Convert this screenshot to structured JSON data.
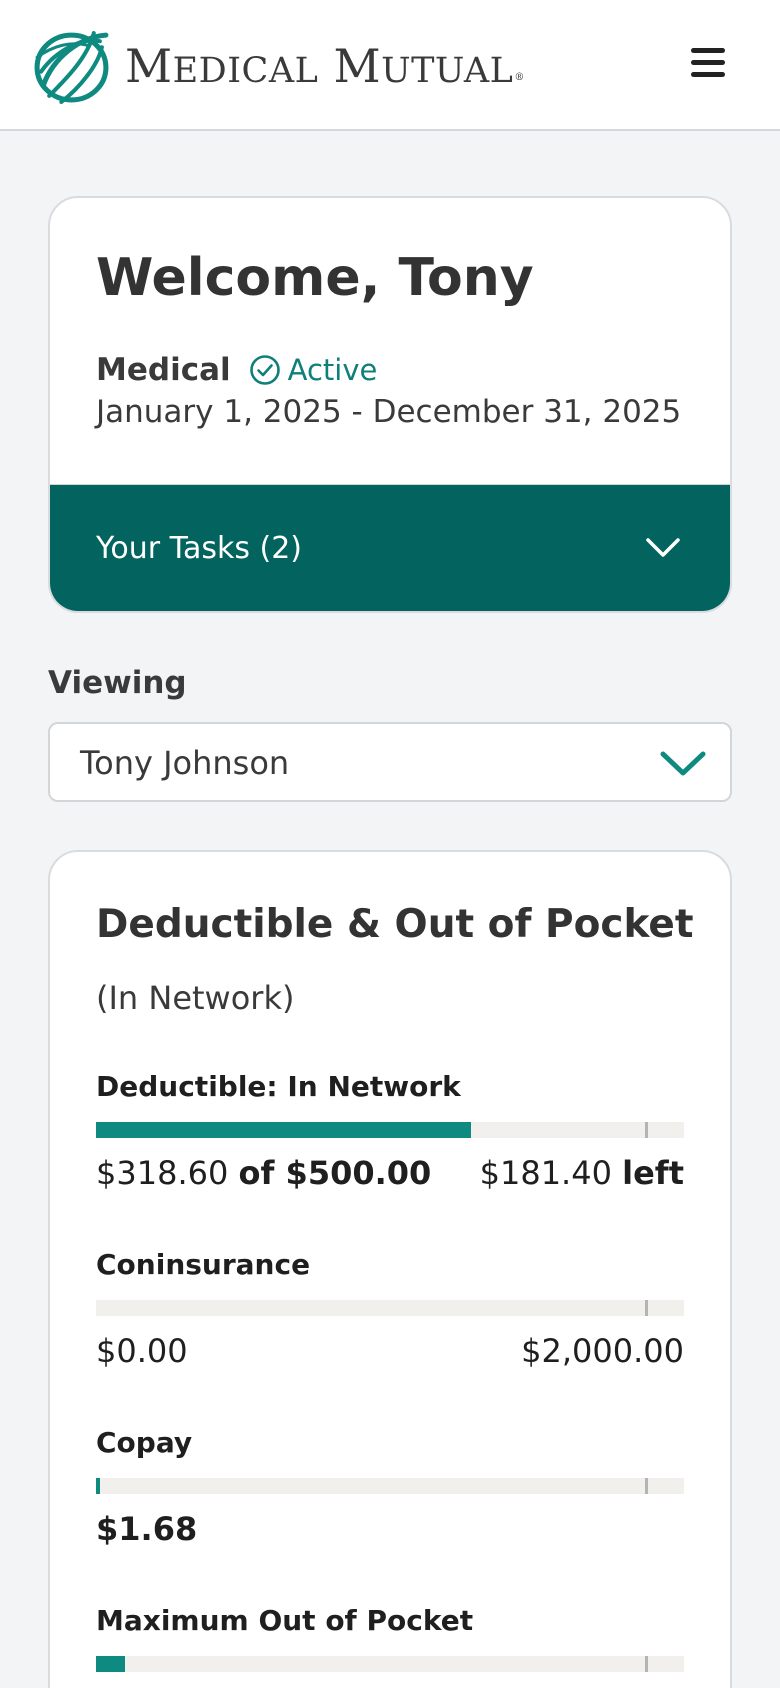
{
  "header": {
    "brand": "MEDICAL MUTUAL",
    "brand_parts": {
      "m1": "M",
      "r1": "EDICAL",
      "m2": "M",
      "r2": "UTUAL",
      "reg": "®"
    },
    "menu_icon": "hamburger-menu-icon",
    "brand_color": "#0f8a80"
  },
  "welcome": {
    "title": "Welcome, Tony",
    "plan_type": "Medical",
    "status": "Active",
    "status_icon": "check-circle-icon",
    "dates": "January 1, 2025 - December 31, 2025",
    "tasks_label": "Your Tasks (2)",
    "tasks_icon": "chevron-down-icon",
    "tasks_color": "#02635f"
  },
  "viewing": {
    "label": "Viewing",
    "selected": "Tony Johnson",
    "icon": "chevron-down-icon"
  },
  "accumulators": {
    "title": "Deductible & Out of Pocket",
    "subtitle": "(In Network)",
    "items": [
      {
        "label": "Deductible: In Network",
        "used": "$318.60",
        "of_text": "of $500.00",
        "remaining": "$181.40",
        "left_text": "left",
        "progress": 0.637
      },
      {
        "label": "Coninsurance",
        "used": "$0.00",
        "limit": "$2,000.00",
        "progress": 0
      },
      {
        "label": "Copay",
        "used": "$1.68",
        "progress": 0.003
      },
      {
        "label": "Maximum Out of Pocket",
        "progress": 0.05
      }
    ]
  }
}
